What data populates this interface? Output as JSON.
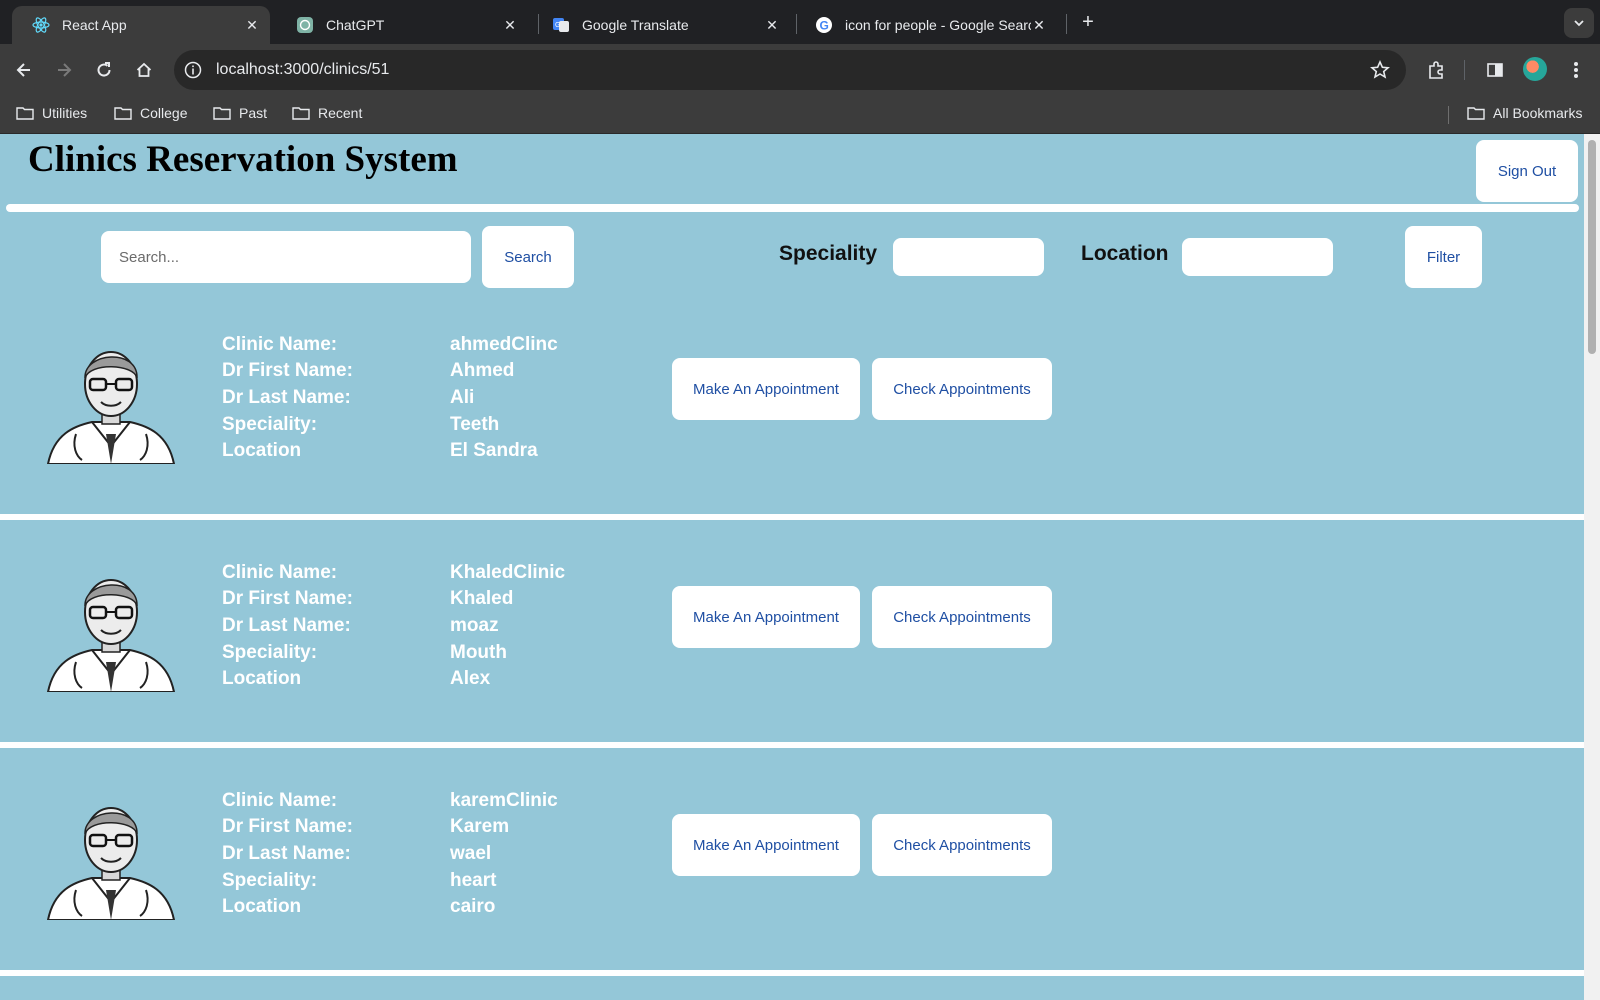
{
  "browser": {
    "tabs": [
      {
        "title": "React App",
        "icon": "react-icon",
        "active": true
      },
      {
        "title": "ChatGPT",
        "icon": "chatgpt-icon",
        "active": false
      },
      {
        "title": "Google Translate",
        "icon": "google-translate-icon",
        "active": false
      },
      {
        "title": "icon for people - Google Search",
        "icon": "google-icon",
        "active": false
      }
    ],
    "url": "localhost:3000/clinics/51",
    "bookmarks": [
      "Utilities",
      "College",
      "Past",
      "Recent"
    ],
    "all_bookmarks": "All Bookmarks"
  },
  "app": {
    "title": "Clinics Reservation System",
    "sign_out_label": "Sign Out"
  },
  "search": {
    "placeholder": "Search...",
    "value": "",
    "button_label": "Search"
  },
  "filters": {
    "speciality_label": "Speciality",
    "speciality_value": "",
    "location_label": "Location",
    "location_value": "",
    "button_label": "Filter"
  },
  "labels": {
    "clinic_name": "Clinic Name:",
    "first_name": "Dr First Name:",
    "last_name": "Dr Last Name:",
    "speciality": "Speciality:",
    "location": "Location"
  },
  "actions": {
    "make_appointment": "Make An Appointment",
    "check_appointments": "Check Appointments"
  },
  "clinics": [
    {
      "clinic_name": "ahmedClinc",
      "first_name": "Ahmed",
      "last_name": "Ali",
      "speciality": "Teeth",
      "location": "El Sandra"
    },
    {
      "clinic_name": "KhaledClinic",
      "first_name": "Khaled",
      "last_name": "moaz",
      "speciality": "Mouth",
      "location": "Alex"
    },
    {
      "clinic_name": "karemClinic",
      "first_name": "Karem",
      "last_name": "wael",
      "speciality": "heart",
      "location": "cairo"
    }
  ],
  "colors": {
    "page_background": "#94c7d8",
    "button_text": "#1f4fa3",
    "browser_dark": "#202124"
  }
}
